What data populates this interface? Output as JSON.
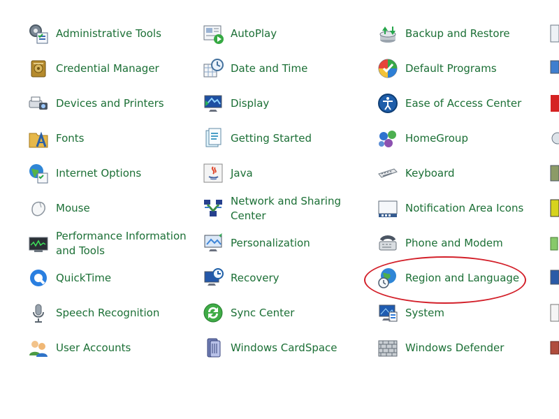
{
  "control_panel": {
    "columns": [
      {
        "items": [
          {
            "label": "Administrative Tools",
            "icon": "admin-tools-icon"
          },
          {
            "label": "Credential Manager",
            "icon": "credential-manager-icon"
          },
          {
            "label": "Devices and Printers",
            "icon": "devices-printers-icon"
          },
          {
            "label": "Fonts",
            "icon": "fonts-icon"
          },
          {
            "label": "Internet Options",
            "icon": "internet-options-icon"
          },
          {
            "label": "Mouse",
            "icon": "mouse-icon"
          },
          {
            "label": "Performance Information and Tools",
            "icon": "performance-icon"
          },
          {
            "label": "QuickTime",
            "icon": "quicktime-icon"
          },
          {
            "label": "Speech Recognition",
            "icon": "microphone-icon"
          },
          {
            "label": "User Accounts",
            "icon": "user-accounts-icon"
          }
        ]
      },
      {
        "items": [
          {
            "label": "AutoPlay",
            "icon": "autoplay-icon"
          },
          {
            "label": "Date and Time",
            "icon": "date-time-icon"
          },
          {
            "label": "Display",
            "icon": "display-icon"
          },
          {
            "label": "Getting Started",
            "icon": "getting-started-icon"
          },
          {
            "label": "Java",
            "icon": "java-icon"
          },
          {
            "label": "Network and Sharing Center",
            "icon": "network-sharing-icon"
          },
          {
            "label": "Personalization",
            "icon": "personalization-icon"
          },
          {
            "label": "Recovery",
            "icon": "recovery-icon"
          },
          {
            "label": "Sync Center",
            "icon": "sync-center-icon"
          },
          {
            "label": "Windows CardSpace",
            "icon": "cardspace-icon"
          }
        ]
      },
      {
        "items": [
          {
            "label": "Backup and Restore",
            "icon": "backup-restore-icon"
          },
          {
            "label": "Default Programs",
            "icon": "default-programs-icon"
          },
          {
            "label": "Ease of Access Center",
            "icon": "ease-of-access-icon"
          },
          {
            "label": "HomeGroup",
            "icon": "homegroup-icon"
          },
          {
            "label": "Keyboard",
            "icon": "keyboard-icon"
          },
          {
            "label": "Notification Area Icons",
            "icon": "notification-area-icon"
          },
          {
            "label": "Phone and Modem",
            "icon": "phone-modem-icon"
          },
          {
            "label": "Region and Language",
            "icon": "region-language-icon",
            "highlighted": true
          },
          {
            "label": "System",
            "icon": "system-icon"
          },
          {
            "label": "Windows Defender",
            "icon": "windows-defender-icon"
          }
        ]
      }
    ],
    "annotation_color": "#d3202a",
    "label_color": "#1b6f35"
  }
}
